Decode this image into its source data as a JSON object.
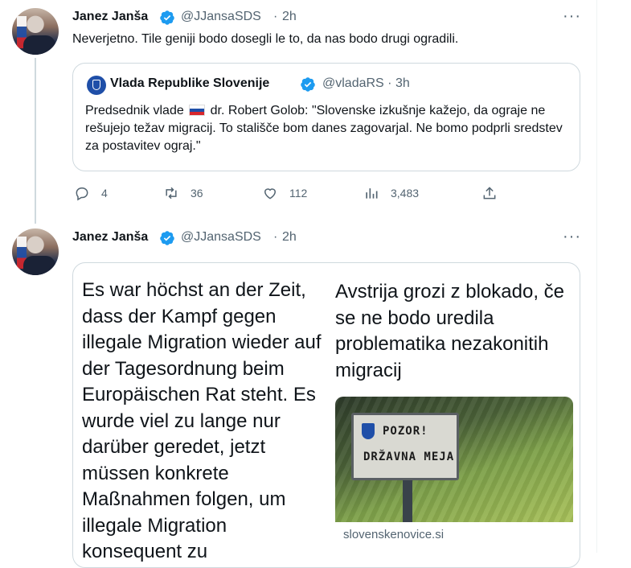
{
  "tweet1": {
    "name": "Janez Janša",
    "handle": "@JJansaSDS",
    "sep": "·",
    "time": "2h",
    "text": "Neverjetno. Tile geniji bodo dosegli le to, da nas bodo drugi ogradili.",
    "quote": {
      "name": "Vlada Republike Slovenije",
      "handle": "@vladaRS",
      "sep": "·",
      "time": "3h",
      "text_before_flag": "Predsednik vlade",
      "text_after_flag": "dr. Robert Golob: \"Slovenske izkušnje kažejo, da ograje ne rešujejo težav migracij. To stališče bom danes zagovarjal. Ne bomo podprli sredstev za postavitev ograj.\""
    },
    "actions": {
      "replies": "4",
      "reposts": "36",
      "likes": "112",
      "views": "3,483"
    }
  },
  "tweet2": {
    "name": "Janez Janša",
    "handle": "@JJansaSDS",
    "sep": "·",
    "time": "2h",
    "image_text": "Es war höchst an der Zeit, dass der Kampf gegen illegale Migration wieder auf der Tagesordnung beim Europäischen Rat steht. Es wurde viel zu lange nur darüber geredet, jetzt müssen konkrete Maßnahmen folgen, um illegale Migration konsequent zu",
    "link_card": {
      "headline": "Avstrija grozi z blokado, če se ne bodo uredila problematika nezakonitih migracij",
      "sign_line1": "POZOR!",
      "sign_line2": "DRŽAVNA MEJA",
      "domain": "slovenskenovice.si",
      "title_partial": "Avstrija grozi z blokado, če se ne..."
    }
  },
  "icons": {
    "verified_color": "#1d9bf0",
    "muted_color": "#536471"
  }
}
